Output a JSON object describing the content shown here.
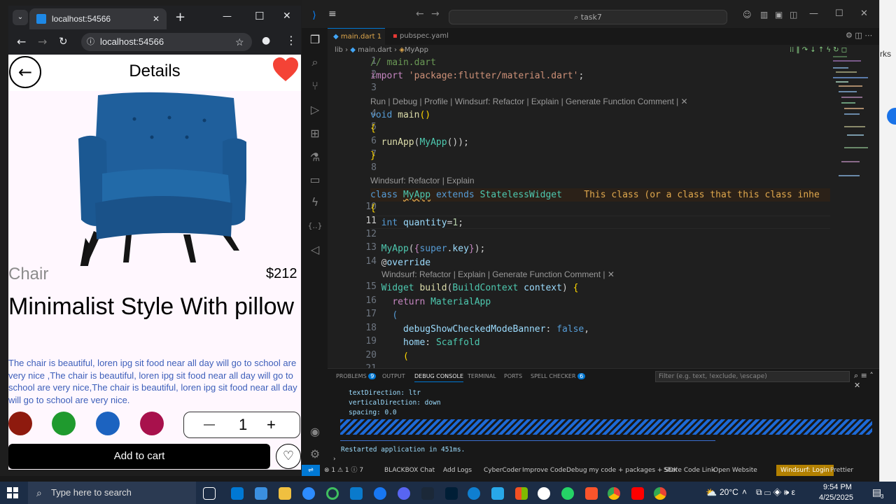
{
  "browser": {
    "tab_title": "localhost:54566",
    "address": "localhost:54566",
    "new_tab": "+",
    "minimize": "—",
    "maximize": "☐",
    "close": "✕"
  },
  "app": {
    "title": "Details",
    "category": "Chair",
    "price": "$212",
    "product_name": "Minimalist Style With pillow",
    "description": "The chair is beautiful, loren ipg sit food near all day will go to school are very nice ,The chair is beautiful, loren ipg sit food near all day will go to school are very nice,The chair is beautiful, loren ipg sit food near all day will go to school are very nice.",
    "colors": [
      "#8e1a0e",
      "#1f9a2e",
      "#1c63c0",
      "#a8114c"
    ],
    "quantity": "1",
    "minus": "—",
    "plus": "+",
    "add_to_cart": "Add to cart",
    "accent_heart": "#f44336"
  },
  "vscode": {
    "search": "task7",
    "tabs": [
      {
        "label": "main.dart 1"
      },
      {
        "label": "pubspec.yaml"
      }
    ],
    "breadcrumb": [
      "lib",
      "main.dart",
      "MyApp"
    ],
    "line_numbers": [
      "1",
      "2",
      "3",
      "4",
      "5",
      "6",
      "7",
      "8",
      "9",
      "10",
      "11",
      "12",
      "13",
      "14",
      "15",
      "16",
      "17",
      "18",
      "19",
      "20",
      "21"
    ],
    "codelens": {
      "main": "Run | Debug | Profile | Windsurf: Refactor | Explain | Generate Function Comment | ✕",
      "myapp": "Windsurf: Refactor | Explain",
      "build": "Windsurf: Refactor | Explain | Generate Function Comment | ✕"
    },
    "diagnostic": "This class (or a class that this class inhe",
    "panel": {
      "tabs": [
        "PROBLEMS",
        "OUTPUT",
        "DEBUG CONSOLE",
        "TERMINAL",
        "PORTS",
        "SPELL CHECKER"
      ],
      "problems_count": "9",
      "spell_count": "6",
      "filter_placeholder": "Filter (e.g. text, !exclude, \\escape)",
      "console_lines": [
        "textDirection: ltr",
        "verticalDirection: down",
        "spacing: 0.0"
      ],
      "restarted": "Restarted application in 451ms."
    },
    "status": {
      "errors": "⊗ 1 ⚠ 1 ⓘ 7",
      "blackbox": "BLACKBOX Chat",
      "add_logs": "Add Logs",
      "cybercoder": "CyberCoder",
      "improve": "Improve Code",
      "debug": "Debug my code + packages + SDK",
      "share": "Share Code Link",
      "open": "Open Website",
      "windsurf": "Windsurf: Login",
      "prettier": "Prettier"
    }
  },
  "background_window": {
    "text": "rks"
  },
  "taskbar": {
    "search": "Type here to search",
    "temperature": "20°C",
    "time": "9:54 PM",
    "date": "4/25/2025",
    "notification_count": "3"
  }
}
